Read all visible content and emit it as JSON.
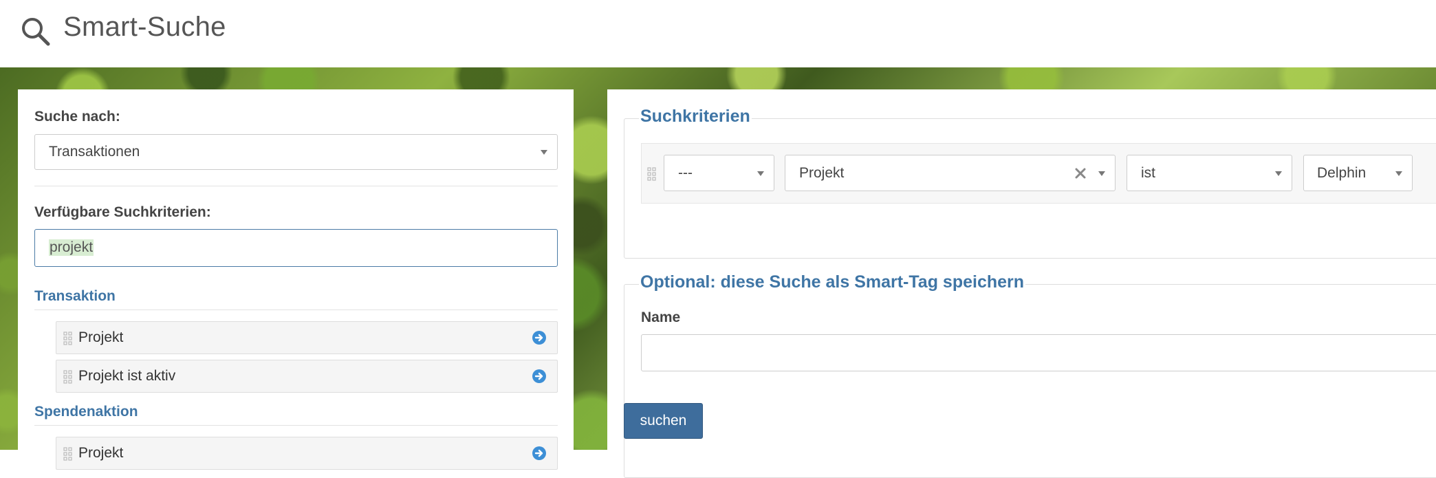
{
  "header": {
    "title": "Smart-Suche",
    "icon": "search-icon"
  },
  "left": {
    "search_for_label": "Suche nach:",
    "search_for_value": "Transaktionen",
    "available_label": "Verfügbare Suchkriterien:",
    "filter_value": "projekt",
    "groups": [
      {
        "title": "Transaktion",
        "items": [
          {
            "label": "Projekt"
          },
          {
            "label": "Projekt ist aktiv"
          }
        ]
      },
      {
        "title": "Spendenaktion",
        "items": [
          {
            "label": "Projekt"
          }
        ]
      }
    ]
  },
  "right": {
    "criteria_legend": "Suchkriterien",
    "row": {
      "connector": "---",
      "field": "Projekt",
      "operator": "ist",
      "value": "Delphin"
    },
    "save_legend": "Optional: diese Suche als Smart-Tag speichern",
    "name_label": "Name",
    "name_value": "",
    "search_button": "suchen"
  },
  "colors": {
    "accent": "#3f75a5",
    "button": "#3e6d9c",
    "highlight": "#d8edd2"
  }
}
